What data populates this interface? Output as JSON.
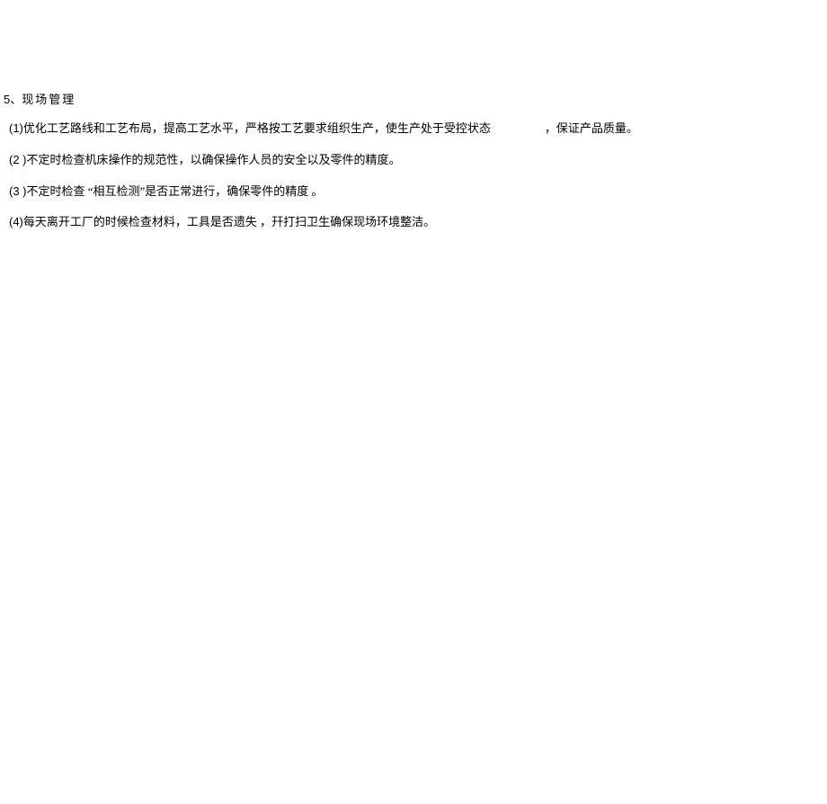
{
  "section": {
    "number": "5",
    "separator": "、",
    "title": "现场管理"
  },
  "items": [
    {
      "number": "(1)",
      "text_part1": "优化工艺路线和工艺布局，提高工艺水平，严格按工艺要求组织生产，使生产处于受控状态",
      "text_part2": "，保证产品质量。",
      "has_gap": true
    },
    {
      "number": "(2 )",
      "text_part1": "不定时检查机床操作的规范性，以确保操作人员的安全以及零件的精度。",
      "text_part2": "",
      "has_gap": false
    },
    {
      "number": "(3 )",
      "text_part1": "不定时检查 “相互检测”是否正常进行，确保零件的精度 。",
      "text_part2": "",
      "has_gap": false
    },
    {
      "number": "(4)",
      "text_part1": "每天离开工厂的时候检查材料，工具是否遗失 ，幵打扫卫生确保现场环境整洁。",
      "text_part2": "",
      "has_gap": false
    }
  ]
}
